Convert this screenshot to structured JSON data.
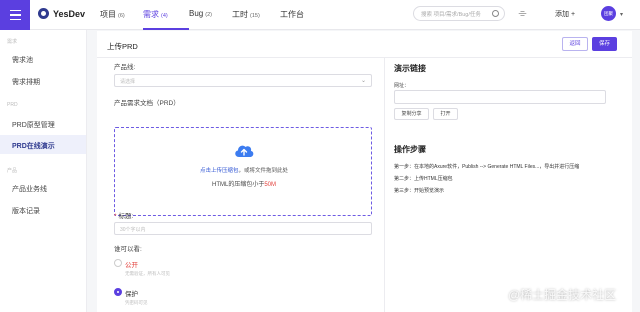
{
  "header": {
    "brand": "YesDev",
    "nav": [
      {
        "label": "项目",
        "count": "(6)"
      },
      {
        "label": "需求",
        "count": "(4)"
      },
      {
        "label": "Bug",
        "count": "(2)"
      },
      {
        "label": "工时",
        "count": "(15)"
      },
      {
        "label": "工作台",
        "count": ""
      }
    ],
    "active_nav": "需求",
    "search_placeholder": "搜索 项目/需求/Bug/任务",
    "add_label": "添加 +",
    "avatar_text": "团聚",
    "accent_color": "#5b3fe0"
  },
  "sidebar": {
    "groups": [
      "需求",
      "PRD",
      "产品"
    ],
    "items": [
      {
        "label": "需求池"
      },
      {
        "label": "需求排期"
      },
      {
        "label": "PRD原型管理"
      },
      {
        "label": "PRD在线演示"
      },
      {
        "label": "产品业务线"
      },
      {
        "label": "版本记录"
      }
    ],
    "active_item": "PRD在线演示"
  },
  "main": {
    "title": "上传PRD",
    "return_label": "返回",
    "save_label": "保存",
    "product_line_label": "产品线:",
    "product_line_placeholder": "请选择",
    "doc_label": "产品需求文档（PRD）",
    "upload_link": "点击上传压缩包",
    "upload_text": "，或将文件拖到此处",
    "upload_hint_prefix": "HTML的压缩包小于",
    "upload_limit": "50M",
    "title_label": "标题:",
    "title_placeholder": "30个字以内",
    "visibility_label": "谁可以看:",
    "options": [
      {
        "label": "公开",
        "desc": "无需验证，所有人可见"
      },
      {
        "label": "保护",
        "desc": "凭密码可见"
      }
    ]
  },
  "demo": {
    "title": "演示链接",
    "url_label": "网址：",
    "copy_label": "复制分享",
    "open_label": "打开",
    "steps_title": "操作步骤",
    "steps": [
      "第一步：在本地的Axure软件，Publish --> Generate HTML Files...，导出并进行压缩",
      "第二步：上传HTML压缩包",
      "第三步：开始预览演示"
    ]
  },
  "watermark": "@稀土掘金技术社区"
}
